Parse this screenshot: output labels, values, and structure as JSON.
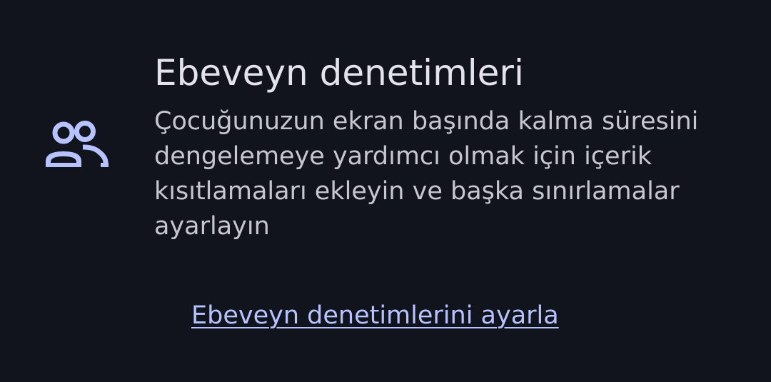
{
  "colors": {
    "background": "#11141d",
    "title": "#e4e3ec",
    "body_text": "#c5c6d0",
    "accent": "#b7c3ff"
  },
  "icon": {
    "name": "people-icon"
  },
  "card": {
    "title": "Ebeveyn denetimleri",
    "description": "Çocuğunuzun ekran başında kalma süresini dengelemeye yardımcı olmak için içerik kısıtlamaları ekleyin ve başka sınırlamalar ayarlayın",
    "action_label": "Ebeveyn denetimlerini ayarla"
  }
}
